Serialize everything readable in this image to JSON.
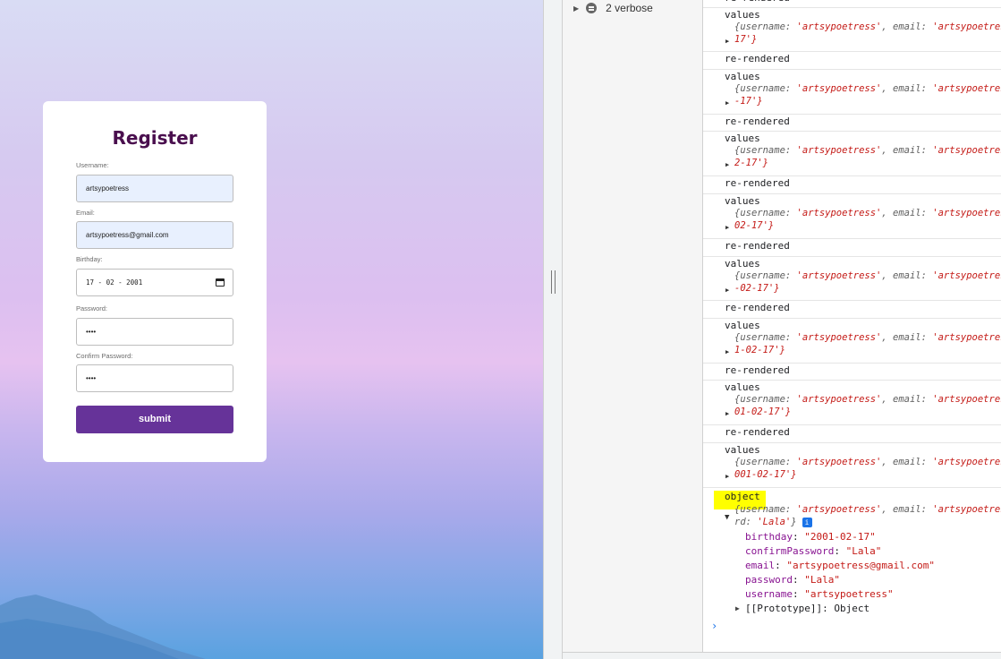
{
  "register_form": {
    "title": "Register",
    "username_label": "Username:",
    "username_value": "artsypoetress",
    "email_label": "Email:",
    "email_value": "artsypoetress@gmail.com",
    "birthday_label": "Birthday:",
    "birthday_value": "17 - 02 - 2001",
    "password_label": "Password:",
    "password_value": "••••",
    "confirm_label": "Confirm Password:",
    "confirm_value": "••••",
    "submit_label": "submit"
  },
  "console_sidebar": {
    "verbose_item": "2 verbose"
  },
  "console_log": {
    "top_partial": "re-rendered",
    "entries": [
      {
        "label": "values",
        "line1_prefix": "{username: ",
        "line1_user": "'artsypoetress'",
        "line1_mid": ", email: ",
        "line1_email": "'artsypoetress",
        "line2": "17'}"
      },
      {
        "label": "re-rendered"
      },
      {
        "label": "values",
        "line1_prefix": "{username: ",
        "line1_user": "'artsypoetress'",
        "line1_mid": ", email: ",
        "line1_email": "'artsypoetress",
        "line2": "-17'}"
      },
      {
        "label": "re-rendered"
      },
      {
        "label": "values",
        "line1_prefix": "{username: ",
        "line1_user": "'artsypoetress'",
        "line1_mid": ", email: ",
        "line1_email": "'artsypoetress",
        "line2": "2-17'}"
      },
      {
        "label": "re-rendered"
      },
      {
        "label": "values",
        "line1_prefix": "{username: ",
        "line1_user": "'artsypoetress'",
        "line1_mid": ", email: ",
        "line1_email": "'artsypoetress",
        "line2": "02-17'}"
      },
      {
        "label": "re-rendered"
      },
      {
        "label": "values",
        "line1_prefix": "{username: ",
        "line1_user": "'artsypoetress'",
        "line1_mid": ", email: ",
        "line1_email": "'artsypoetress",
        "line2": "-02-17'}"
      },
      {
        "label": "re-rendered"
      },
      {
        "label": "values",
        "line1_prefix": "{username: ",
        "line1_user": "'artsypoetress'",
        "line1_mid": ", email: ",
        "line1_email": "'artsypoetress",
        "line2": "1-02-17'}"
      },
      {
        "label": "re-rendered"
      },
      {
        "label": "values",
        "line1_prefix": "{username: ",
        "line1_user": "'artsypoetress'",
        "line1_mid": ", email: ",
        "line1_email": "'artsypoetress",
        "line2": "01-02-17'}"
      },
      {
        "label": "re-rendered"
      },
      {
        "label": "values",
        "line1_prefix": "{username: ",
        "line1_user": "'artsypoetress'",
        "line1_mid": ", email: ",
        "line1_email": "'artsypoetress",
        "line2": "001-02-17'}"
      }
    ],
    "object_entry": {
      "label": "object",
      "line1_prefix": "{username: ",
      "line1_user": "'artsypoetress'",
      "line1_mid": ", email: ",
      "line1_email": "'artsypoetress",
      "line2_key": "rd: ",
      "line2_val": "'Lala'",
      "line2_end": "}",
      "info_badge": "i",
      "properties": [
        {
          "name": "birthday",
          "value": "\"2001-02-17\""
        },
        {
          "name": "confirmPassword",
          "value": "\"Lala\""
        },
        {
          "name": "email",
          "value": "\"artsypoetress@gmail.com\""
        },
        {
          "name": "password",
          "value": "\"Lala\""
        },
        {
          "name": "username",
          "value": "\"artsypoetress\""
        }
      ],
      "prototype": "[[Prototype]]: Object"
    },
    "prompt": "›"
  }
}
